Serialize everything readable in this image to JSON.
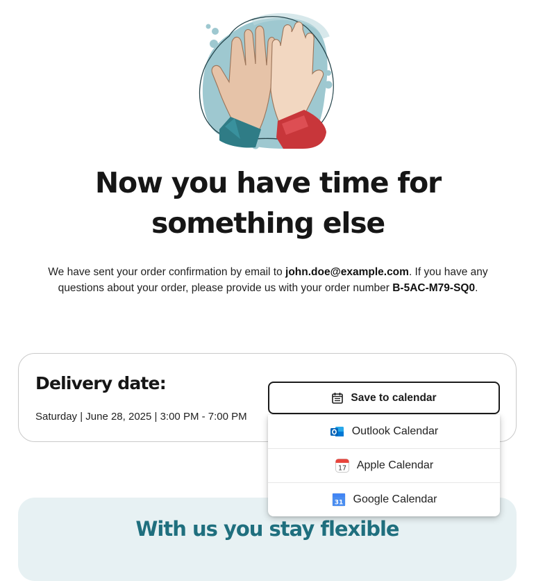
{
  "hero": {
    "illustration": "high-five-hands"
  },
  "headline": "Now you have time for something else",
  "intro": {
    "part1": "We have sent your order confirmation by email to ",
    "email": "john.doe@example.com",
    "part2": ". If you have any questions about your order, please provide us with your order number ",
    "order_number": "B-5AC-M79-SQ0",
    "part3": "."
  },
  "delivery": {
    "title": "Delivery date:",
    "when": "Saturday | June 28, 2025 | 3:00 PM - 7:00 PM"
  },
  "calendar": {
    "button_label": "Save to calendar",
    "button_icon": "calendar-icon",
    "options": [
      {
        "label": "Outlook Calendar",
        "icon": "outlook-icon"
      },
      {
        "label": "Apple Calendar",
        "icon": "apple-calendar-icon",
        "day": "17"
      },
      {
        "label": "Google Calendar",
        "icon": "google-calendar-icon",
        "day": "31"
      }
    ]
  },
  "flexible": {
    "title": "With us you stay flexible"
  },
  "colors": {
    "accent_teal": "#1f6f7e",
    "flex_card_bg": "#e7f1f3",
    "sleeve_teal": "#2f7c86",
    "sleeve_red": "#c8363a"
  }
}
